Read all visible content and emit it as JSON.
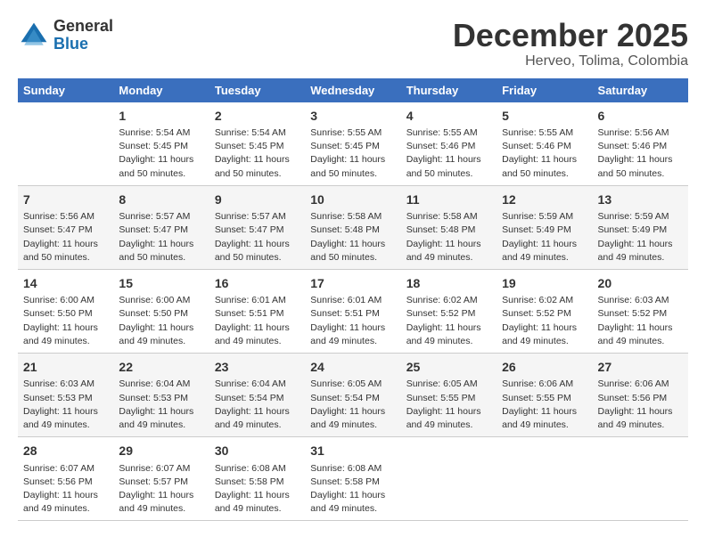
{
  "logo": {
    "line1": "General",
    "line2": "Blue"
  },
  "title": "December 2025",
  "location": "Herveo, Tolima, Colombia",
  "weekdays": [
    "Sunday",
    "Monday",
    "Tuesday",
    "Wednesday",
    "Thursday",
    "Friday",
    "Saturday"
  ],
  "weeks": [
    [
      {
        "day": "",
        "sunrise": "",
        "sunset": "",
        "daylight": ""
      },
      {
        "day": "1",
        "sunrise": "Sunrise: 5:54 AM",
        "sunset": "Sunset: 5:45 PM",
        "daylight": "Daylight: 11 hours and 50 minutes."
      },
      {
        "day": "2",
        "sunrise": "Sunrise: 5:54 AM",
        "sunset": "Sunset: 5:45 PM",
        "daylight": "Daylight: 11 hours and 50 minutes."
      },
      {
        "day": "3",
        "sunrise": "Sunrise: 5:55 AM",
        "sunset": "Sunset: 5:45 PM",
        "daylight": "Daylight: 11 hours and 50 minutes."
      },
      {
        "day": "4",
        "sunrise": "Sunrise: 5:55 AM",
        "sunset": "Sunset: 5:46 PM",
        "daylight": "Daylight: 11 hours and 50 minutes."
      },
      {
        "day": "5",
        "sunrise": "Sunrise: 5:55 AM",
        "sunset": "Sunset: 5:46 PM",
        "daylight": "Daylight: 11 hours and 50 minutes."
      },
      {
        "day": "6",
        "sunrise": "Sunrise: 5:56 AM",
        "sunset": "Sunset: 5:46 PM",
        "daylight": "Daylight: 11 hours and 50 minutes."
      }
    ],
    [
      {
        "day": "7",
        "sunrise": "Sunrise: 5:56 AM",
        "sunset": "Sunset: 5:47 PM",
        "daylight": "Daylight: 11 hours and 50 minutes."
      },
      {
        "day": "8",
        "sunrise": "Sunrise: 5:57 AM",
        "sunset": "Sunset: 5:47 PM",
        "daylight": "Daylight: 11 hours and 50 minutes."
      },
      {
        "day": "9",
        "sunrise": "Sunrise: 5:57 AM",
        "sunset": "Sunset: 5:47 PM",
        "daylight": "Daylight: 11 hours and 50 minutes."
      },
      {
        "day": "10",
        "sunrise": "Sunrise: 5:58 AM",
        "sunset": "Sunset: 5:48 PM",
        "daylight": "Daylight: 11 hours and 50 minutes."
      },
      {
        "day": "11",
        "sunrise": "Sunrise: 5:58 AM",
        "sunset": "Sunset: 5:48 PM",
        "daylight": "Daylight: 11 hours and 49 minutes."
      },
      {
        "day": "12",
        "sunrise": "Sunrise: 5:59 AM",
        "sunset": "Sunset: 5:49 PM",
        "daylight": "Daylight: 11 hours and 49 minutes."
      },
      {
        "day": "13",
        "sunrise": "Sunrise: 5:59 AM",
        "sunset": "Sunset: 5:49 PM",
        "daylight": "Daylight: 11 hours and 49 minutes."
      }
    ],
    [
      {
        "day": "14",
        "sunrise": "Sunrise: 6:00 AM",
        "sunset": "Sunset: 5:50 PM",
        "daylight": "Daylight: 11 hours and 49 minutes."
      },
      {
        "day": "15",
        "sunrise": "Sunrise: 6:00 AM",
        "sunset": "Sunset: 5:50 PM",
        "daylight": "Daylight: 11 hours and 49 minutes."
      },
      {
        "day": "16",
        "sunrise": "Sunrise: 6:01 AM",
        "sunset": "Sunset: 5:51 PM",
        "daylight": "Daylight: 11 hours and 49 minutes."
      },
      {
        "day": "17",
        "sunrise": "Sunrise: 6:01 AM",
        "sunset": "Sunset: 5:51 PM",
        "daylight": "Daylight: 11 hours and 49 minutes."
      },
      {
        "day": "18",
        "sunrise": "Sunrise: 6:02 AM",
        "sunset": "Sunset: 5:52 PM",
        "daylight": "Daylight: 11 hours and 49 minutes."
      },
      {
        "day": "19",
        "sunrise": "Sunrise: 6:02 AM",
        "sunset": "Sunset: 5:52 PM",
        "daylight": "Daylight: 11 hours and 49 minutes."
      },
      {
        "day": "20",
        "sunrise": "Sunrise: 6:03 AM",
        "sunset": "Sunset: 5:52 PM",
        "daylight": "Daylight: 11 hours and 49 minutes."
      }
    ],
    [
      {
        "day": "21",
        "sunrise": "Sunrise: 6:03 AM",
        "sunset": "Sunset: 5:53 PM",
        "daylight": "Daylight: 11 hours and 49 minutes."
      },
      {
        "day": "22",
        "sunrise": "Sunrise: 6:04 AM",
        "sunset": "Sunset: 5:53 PM",
        "daylight": "Daylight: 11 hours and 49 minutes."
      },
      {
        "day": "23",
        "sunrise": "Sunrise: 6:04 AM",
        "sunset": "Sunset: 5:54 PM",
        "daylight": "Daylight: 11 hours and 49 minutes."
      },
      {
        "day": "24",
        "sunrise": "Sunrise: 6:05 AM",
        "sunset": "Sunset: 5:54 PM",
        "daylight": "Daylight: 11 hours and 49 minutes."
      },
      {
        "day": "25",
        "sunrise": "Sunrise: 6:05 AM",
        "sunset": "Sunset: 5:55 PM",
        "daylight": "Daylight: 11 hours and 49 minutes."
      },
      {
        "day": "26",
        "sunrise": "Sunrise: 6:06 AM",
        "sunset": "Sunset: 5:55 PM",
        "daylight": "Daylight: 11 hours and 49 minutes."
      },
      {
        "day": "27",
        "sunrise": "Sunrise: 6:06 AM",
        "sunset": "Sunset: 5:56 PM",
        "daylight": "Daylight: 11 hours and 49 minutes."
      }
    ],
    [
      {
        "day": "28",
        "sunrise": "Sunrise: 6:07 AM",
        "sunset": "Sunset: 5:56 PM",
        "daylight": "Daylight: 11 hours and 49 minutes."
      },
      {
        "day": "29",
        "sunrise": "Sunrise: 6:07 AM",
        "sunset": "Sunset: 5:57 PM",
        "daylight": "Daylight: 11 hours and 49 minutes."
      },
      {
        "day": "30",
        "sunrise": "Sunrise: 6:08 AM",
        "sunset": "Sunset: 5:58 PM",
        "daylight": "Daylight: 11 hours and 49 minutes."
      },
      {
        "day": "31",
        "sunrise": "Sunrise: 6:08 AM",
        "sunset": "Sunset: 5:58 PM",
        "daylight": "Daylight: 11 hours and 49 minutes."
      },
      {
        "day": "",
        "sunrise": "",
        "sunset": "",
        "daylight": ""
      },
      {
        "day": "",
        "sunrise": "",
        "sunset": "",
        "daylight": ""
      },
      {
        "day": "",
        "sunrise": "",
        "sunset": "",
        "daylight": ""
      }
    ]
  ]
}
